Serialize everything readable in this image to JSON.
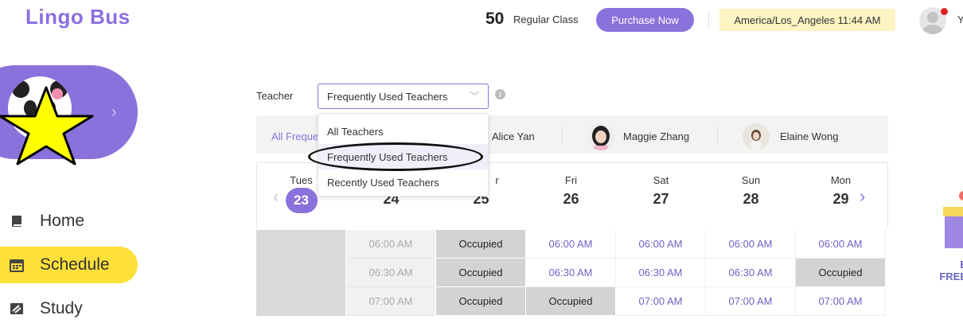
{
  "header": {
    "logo": "Lingo Bus",
    "class_count": "50",
    "class_label": "Regular Class",
    "purchase_label": "Purchase Now",
    "timezone": "America/Los_Angeles 11:44 AM",
    "user_initial": "Y"
  },
  "sidebar": {
    "items": [
      {
        "label": "Home",
        "icon": "book-icon"
      },
      {
        "label": "Schedule",
        "icon": "calendar-icon"
      },
      {
        "label": "Study",
        "icon": "study-icon"
      }
    ]
  },
  "teacher_filter": {
    "label": "Teacher",
    "selected": "Frequently Used Teachers",
    "options": [
      "All Teachers",
      "Frequently Used Teachers",
      "Recently Used Teachers"
    ]
  },
  "teacher_strip": {
    "first": "All Freque",
    "teachers": [
      "Alice Yan",
      "Maggie Zhang",
      "Elaine Wong"
    ]
  },
  "calendar": {
    "days": [
      {
        "name": "Tues",
        "num": "23",
        "today": true
      },
      {
        "name": "",
        "num": "24",
        "today": false
      },
      {
        "name": "r",
        "num": "25",
        "today": false
      },
      {
        "name": "Fri",
        "num": "26",
        "today": false
      },
      {
        "name": "Sat",
        "num": "27",
        "today": false
      },
      {
        "name": "Sun",
        "num": "28",
        "today": false
      },
      {
        "name": "Mon",
        "num": "29",
        "today": false
      }
    ],
    "rows": [
      [
        "",
        "06:00 AM",
        "Occupied",
        "06:00 AM",
        "06:00 AM",
        "06:00 AM",
        "06:00 AM"
      ],
      [
        "",
        "06:30 AM",
        "Occupied",
        "06:30 AM",
        "06:30 AM",
        "06:30 AM",
        "Occupied"
      ],
      [
        "",
        "07:00 AM",
        "Occupied",
        "Occupied",
        "07:00 AM",
        "07:00 AM",
        "07:00 AM"
      ]
    ],
    "row_types": [
      [
        "blank",
        "past",
        "occ",
        "open",
        "open",
        "open",
        "open"
      ],
      [
        "blank",
        "past",
        "occ",
        "open",
        "open",
        "open",
        "occ"
      ],
      [
        "blank",
        "past",
        "occ",
        "occ",
        "open",
        "open",
        "open"
      ]
    ]
  },
  "promo": {
    "line1": "E",
    "line2": "FREE"
  },
  "colors": {
    "brand": "#8a72dc",
    "highlight": "#fde03a",
    "slot_link": "#6d64c4"
  }
}
